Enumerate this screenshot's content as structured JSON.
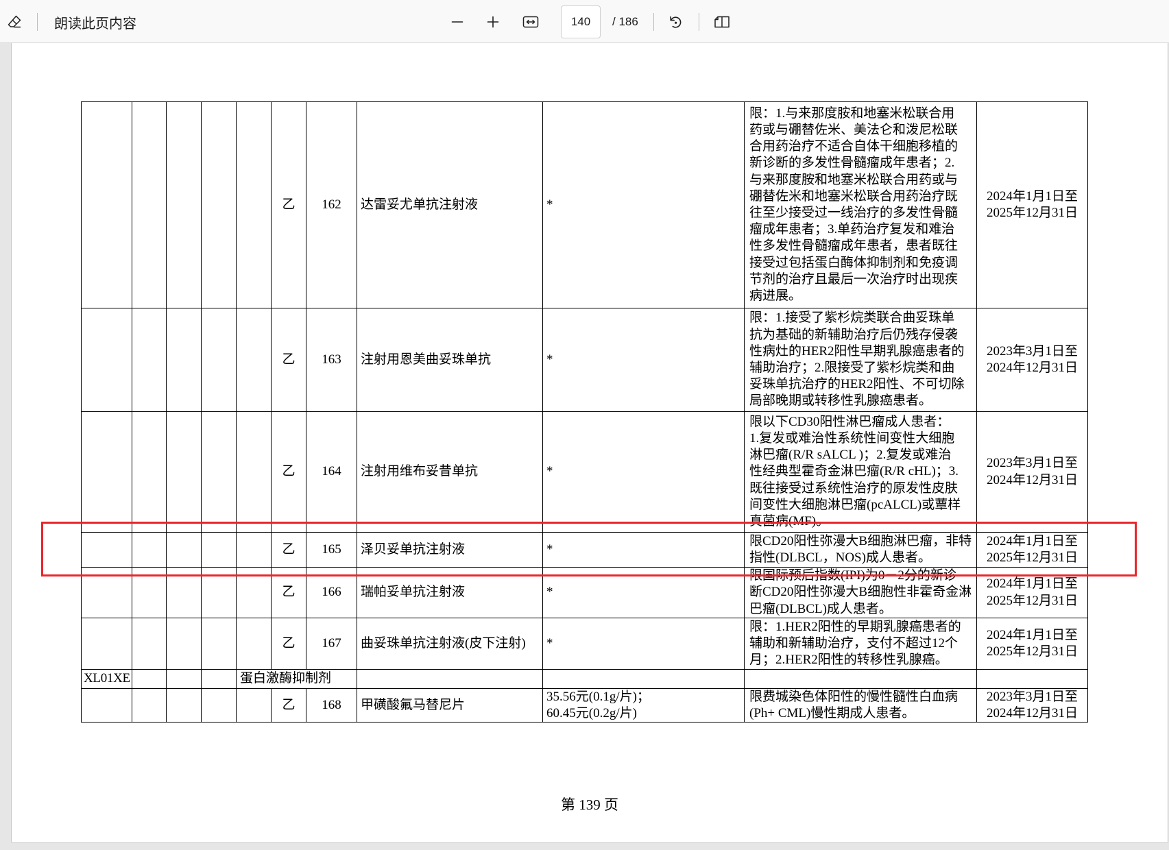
{
  "viewer": {
    "toolbar": {
      "erase_icon": "eraser-icon",
      "read_aloud_label": "朗读此页内容",
      "zoom_out_icon": "minus-icon",
      "zoom_in_icon": "plus-icon",
      "fit_icon": "fit-to-page-icon",
      "current_page": "140",
      "total_pages": "/ 186",
      "rotate_icon": "rotate-icon",
      "page_view_icon": "two-page-view-icon"
    }
  },
  "document": {
    "table": {
      "rows": [
        {
          "type": "drug",
          "category": "乙",
          "number": "162",
          "name": "达雷妥尤单抗注射液",
          "price": [
            "*"
          ],
          "remarks": [
            "限：1.与来那度胺和地塞米松联合用",
            "药或与硼替佐米、美法仑和泼尼松联",
            "合用药治疗不适合自体干细胞移植的",
            "新诊断的多发性骨髓瘤成年患者；2.",
            "与来那度胺和地塞米松联合用药或与",
            "硼替佐米和地塞米松联合用药治疗既",
            "往至少接受过一线治疗的多发性骨髓",
            "瘤成年患者；3.单药治疗复发和难治",
            "性多发性骨髓瘤成年患者，患者既往",
            "接受过包括蛋白酶体抑制剂和免疫调",
            "节剂的治疗且最后一次治疗时出现疾",
            "病进展。"
          ],
          "period": [
            "2024年1月1日至",
            "2025年12月31日"
          ]
        },
        {
          "type": "drug",
          "category": "乙",
          "number": "163",
          "name": "注射用恩美曲妥珠单抗",
          "price": [
            "*"
          ],
          "remarks": [
            "限：1.接受了紫杉烷类联合曲妥珠单",
            "抗为基础的新辅助治疗后仍残存侵袭",
            "性病灶的HER2阳性早期乳腺癌患者的",
            "辅助治疗；2.限接受了紫杉烷类和曲",
            "妥珠单抗治疗的HER2阳性、不可切除",
            "局部晚期或转移性乳腺癌患者。"
          ],
          "period": [
            "2023年3月1日至",
            "2024年12月31日"
          ]
        },
        {
          "type": "drug",
          "category": "乙",
          "number": "164",
          "name": "注射用维布妥昔单抗",
          "price": [
            "*"
          ],
          "remarks": [
            "限以下CD30阳性淋巴瘤成人患者：",
            "1.复发或难治性系统性间变性大细胞",
            "淋巴瘤(R/R sALCL )；2.复发或难治",
            "性经典型霍奇金淋巴瘤(R/R cHL)；3.",
            "既往接受过系统性治疗的原发性皮肤",
            "间变性大细胞淋巴瘤(pcALCL)或蕈样",
            "真菌病(MF)。"
          ],
          "period": [
            "2023年3月1日至",
            "2024年12月31日"
          ]
        },
        {
          "type": "drug",
          "category": "乙",
          "number": "165",
          "name": "泽贝妥单抗注射液",
          "price": [
            "*"
          ],
          "remarks": [
            "限CD20阳性弥漫大B细胞淋巴瘤，非特",
            "指性(DLBCL，NOS)成人患者。"
          ],
          "period": [
            "2024年1月1日至",
            "2025年12月31日"
          ]
        },
        {
          "type": "drug",
          "category": "乙",
          "number": "166",
          "name": "瑞帕妥单抗注射液",
          "price": [
            "*"
          ],
          "remarks": [
            "限国际预后指数(IPI)为0－2分的新诊",
            "断CD20阳性弥漫大B细胞性非霍奇金淋",
            "巴瘤(DLBCL)成人患者。"
          ],
          "period": [
            "2024年1月1日至",
            "2025年12月31日"
          ]
        },
        {
          "type": "drug",
          "category": "乙",
          "number": "167",
          "name": "曲妥珠单抗注射液(皮下注射)",
          "price": [
            "*"
          ],
          "remarks": [
            "限：1.HER2阳性的早期乳腺癌患者的",
            "辅助和新辅助治疗，支付不超过12个",
            "月；2.HER2阳性的转移性乳腺癌。"
          ],
          "period": [
            "2024年1月1日至",
            "2025年12月31日"
          ]
        },
        {
          "type": "group",
          "code": "XL01XE",
          "class_name": "蛋白激酶抑制剂"
        },
        {
          "type": "drug",
          "category": "乙",
          "number": "168",
          "name": "甲磺酸氟马替尼片",
          "price": [
            "35.56元(0.1g/片)；",
            "60.45元(0.2g/片)"
          ],
          "remarks": [
            "限费城染色体阳性的慢性髓性白血病",
            "(Ph+ CML)慢性期成人患者。"
          ],
          "period": [
            "2023年3月1日至",
            "2024年12月31日"
          ]
        }
      ]
    },
    "footer": "第 139 页"
  },
  "annotation": {
    "color": "#e8262b"
  }
}
